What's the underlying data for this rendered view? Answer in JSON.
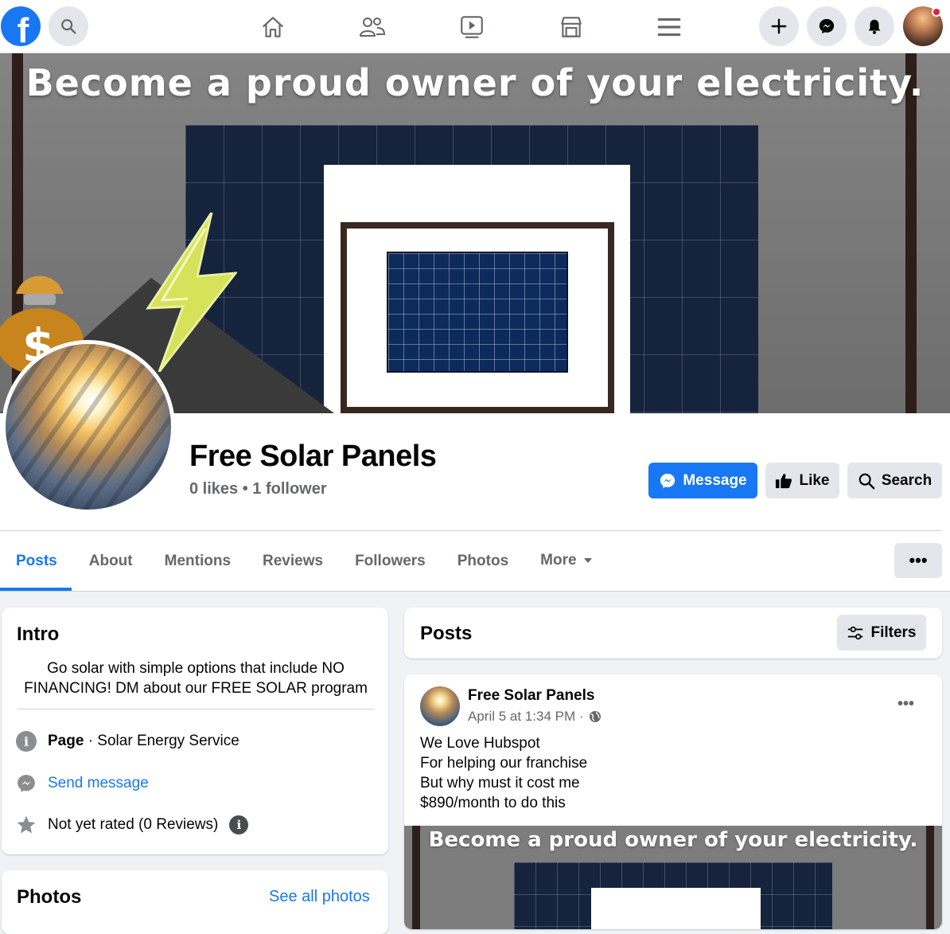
{
  "nav": {
    "logo_letter": "f",
    "icons": [
      "search-icon",
      "home-icon",
      "friends-icon",
      "watch-icon",
      "marketplace-icon",
      "menu-icon",
      "create-icon",
      "messenger-icon",
      "notifications-icon"
    ]
  },
  "cover": {
    "headline": "Become a proud owner of your electricity."
  },
  "page": {
    "name": "Free Solar Panels",
    "stats": "0 likes • 1 follower"
  },
  "actions": {
    "message_label": "Message",
    "like_label": "Like",
    "search_label": "Search"
  },
  "tabs": [
    {
      "label": "Posts",
      "active": true
    },
    {
      "label": "About"
    },
    {
      "label": "Mentions"
    },
    {
      "label": "Reviews"
    },
    {
      "label": "Followers"
    },
    {
      "label": "Photos"
    },
    {
      "label": "More"
    }
  ],
  "more_menu": "•••",
  "intro": {
    "title": "Intro",
    "bio": "Go solar with simple options that include NO FINANCING! DM about our FREE SOLAR program",
    "page_type_bold": "Page",
    "page_type_rest": " · Solar Energy Service",
    "send_message": "Send message",
    "rating": "Not yet rated (0 Reviews)"
  },
  "photos": {
    "title": "Photos",
    "see_all": "See all photos"
  },
  "posts": {
    "title": "Posts",
    "filters_label": "Filters",
    "items": [
      {
        "author": "Free Solar Panels",
        "timestamp": "April 5 at 1:34 PM ·",
        "dots": "•••",
        "text": "We Love Hubspot\nFor helping our franchise\nBut why must it cost me\n$890/month to do this",
        "image_headline": "Become a proud owner of your electricity."
      }
    ]
  },
  "colors": {
    "accent": "#1877f2",
    "background": "#f0f2f5",
    "secondary_text": "#65676b",
    "notification": "#e41e3f"
  }
}
